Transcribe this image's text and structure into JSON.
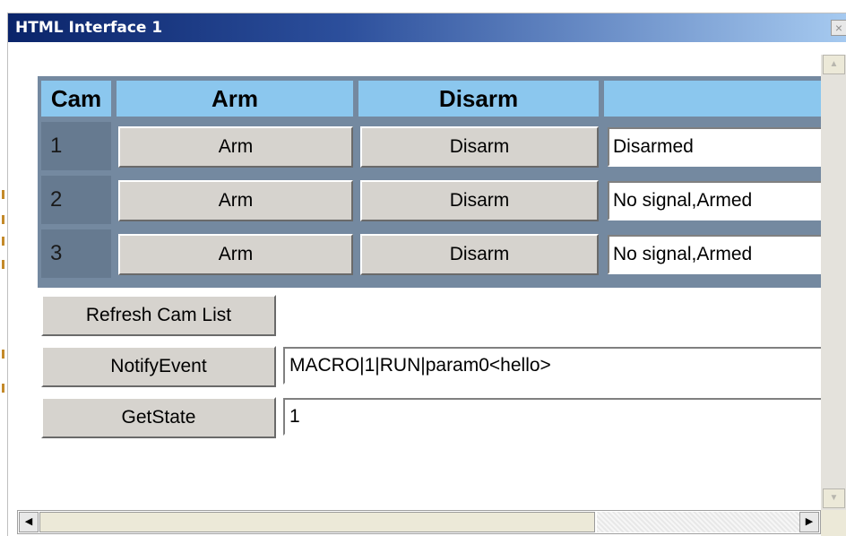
{
  "window": {
    "title": "HTML Interface 1",
    "close_glyph": "×"
  },
  "cam_table": {
    "headers": {
      "cam": "Cam",
      "arm": "Arm",
      "disarm": "Disarm",
      "status": ""
    },
    "rows": [
      {
        "cam": "1",
        "arm_label": "Arm",
        "disarm_label": "Disarm",
        "status": "Disarmed"
      },
      {
        "cam": "2",
        "arm_label": "Arm",
        "disarm_label": "Disarm",
        "status": "No signal,Armed"
      },
      {
        "cam": "3",
        "arm_label": "Arm",
        "disarm_label": "Disarm",
        "status": "No signal,Armed"
      }
    ]
  },
  "controls": {
    "refresh_label": "Refresh Cam List",
    "notify_label": "NotifyEvent",
    "notify_value": "MACRO|1|RUN|param0<hello>",
    "getstate_label": "GetState",
    "getstate_value": "1"
  },
  "scrollbar": {
    "up_glyph": "▲",
    "down_glyph": "▼",
    "left_glyph": "◀",
    "right_glyph": "▶"
  },
  "colors": {
    "header_bg": "#8bc7ee",
    "table_bg": "#7489a0",
    "button_face": "#d6d3ce"
  }
}
